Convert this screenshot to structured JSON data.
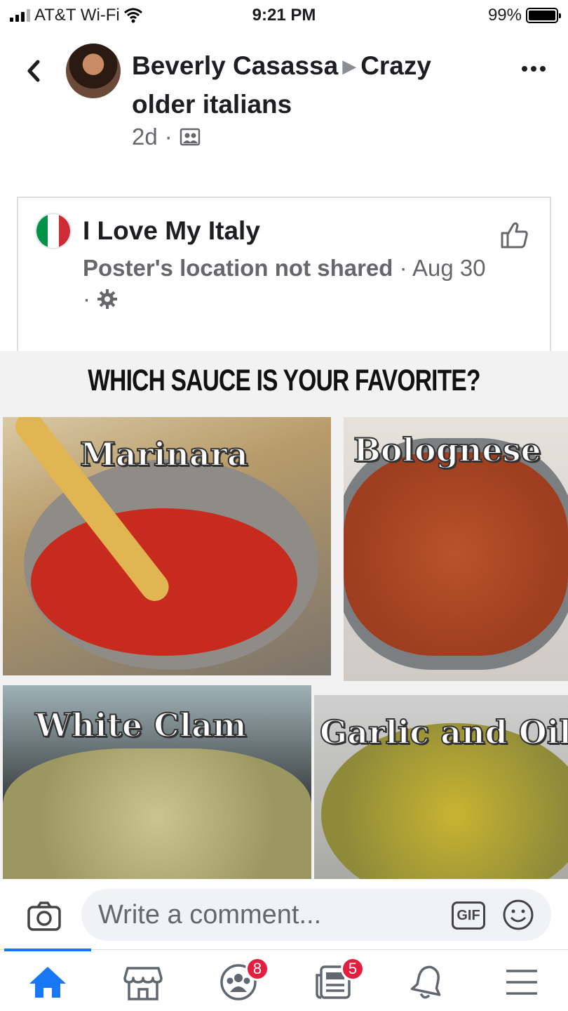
{
  "status_bar": {
    "carrier": "AT&T Wi-Fi",
    "time": "9:21 PM",
    "battery": "99%",
    "battery_level": 0.99
  },
  "post": {
    "author": "Beverly Casassa",
    "group": "Crazy older italians",
    "age": "2d",
    "separator": "·"
  },
  "shared": {
    "page_name": "I Love My Italy",
    "location": "Poster's location not shared",
    "date": "Aug 30"
  },
  "image": {
    "title": "WHICH SAUCE IS YOUR FAVORITE?",
    "panels": [
      "Marinara",
      "Bolognese",
      "White Clam",
      "Garlic and Oil"
    ]
  },
  "comment": {
    "placeholder": "Write a comment...",
    "gif_label": "GIF"
  },
  "tabs": {
    "groups_badge": "8",
    "news_badge": "5"
  },
  "colors": {
    "accent": "#1877f2",
    "badge": "#e41e3f",
    "flag_green": "#009246",
    "flag_red": "#ce2b37"
  },
  "icons": [
    "back-chevron-icon",
    "more-icon",
    "photo-album-icon",
    "like-icon",
    "settings-gear-icon",
    "camera-icon",
    "gif-icon",
    "emoji-icon",
    "home-icon",
    "marketplace-icon",
    "groups-icon",
    "news-icon",
    "bell-icon",
    "menu-icon"
  ]
}
